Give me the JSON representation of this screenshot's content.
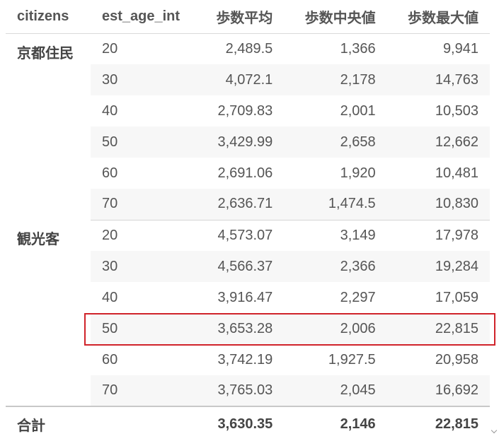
{
  "columns": [
    "citizens",
    "est_age_int",
    "歩数平均",
    "歩数中央値",
    "歩数最大値"
  ],
  "groups": [
    {
      "name": "京都住民",
      "rows": [
        {
          "age": "20",
          "mean": "2,489.5",
          "median": "1,366",
          "max": "9,941"
        },
        {
          "age": "30",
          "mean": "4,072.1",
          "median": "2,178",
          "max": "14,763"
        },
        {
          "age": "40",
          "mean": "2,709.83",
          "median": "2,001",
          "max": "10,503"
        },
        {
          "age": "50",
          "mean": "3,429.99",
          "median": "2,658",
          "max": "12,662"
        },
        {
          "age": "60",
          "mean": "2,691.06",
          "median": "1,920",
          "max": "10,481"
        },
        {
          "age": "70",
          "mean": "2,636.71",
          "median": "1,474.5",
          "max": "10,830"
        }
      ]
    },
    {
      "name": "観光客",
      "rows": [
        {
          "age": "20",
          "mean": "4,573.07",
          "median": "3,149",
          "max": "17,978"
        },
        {
          "age": "30",
          "mean": "4,566.37",
          "median": "2,366",
          "max": "19,284"
        },
        {
          "age": "40",
          "mean": "3,916.47",
          "median": "2,297",
          "max": "17,059"
        },
        {
          "age": "50",
          "mean": "3,653.28",
          "median": "2,006",
          "max": "22,815"
        },
        {
          "age": "60",
          "mean": "3,742.19",
          "median": "1,927.5",
          "max": "20,958"
        },
        {
          "age": "70",
          "mean": "3,765.03",
          "median": "2,045",
          "max": "16,692"
        }
      ]
    }
  ],
  "total": {
    "label": "合計",
    "age": "",
    "mean": "3,630.35",
    "median": "2,146",
    "max": "22,815"
  },
  "highlight": {
    "group": 1,
    "row": 3,
    "color": "#d0232a"
  }
}
